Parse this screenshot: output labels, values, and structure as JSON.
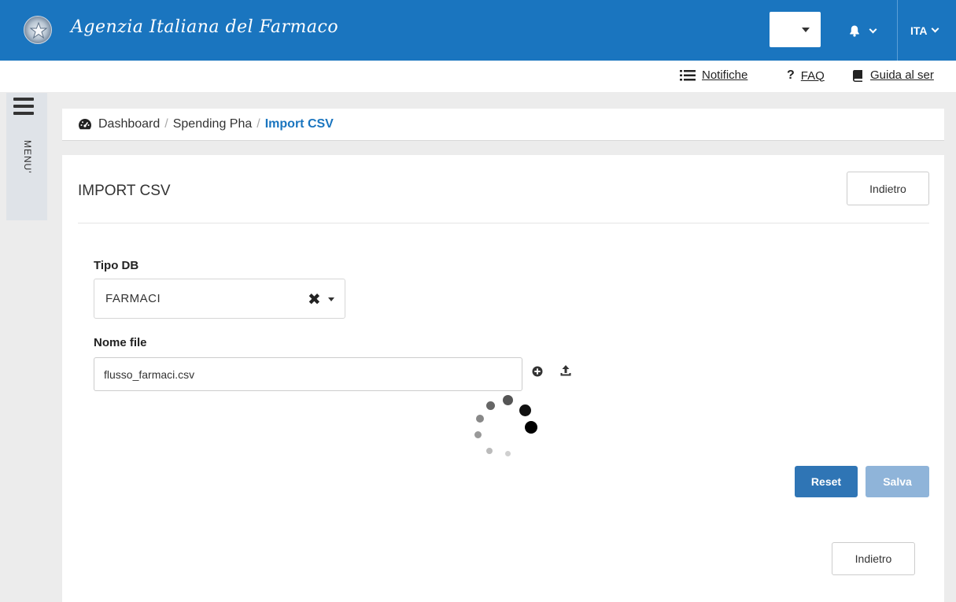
{
  "header": {
    "brand": "Agenzia Italiana del Farmaco",
    "language": "ITA"
  },
  "topnav": {
    "notifications": "Notifiche",
    "faq": "FAQ",
    "guide": "Guida al ser"
  },
  "sidebar": {
    "menu_label": "MENU'"
  },
  "breadcrumb": {
    "items": [
      "Dashboard",
      "Spending Pha",
      "Import CSV"
    ],
    "separator": "/"
  },
  "panel": {
    "title": "IMPORT CSV",
    "back_label": "Indietro",
    "tipo_db": {
      "label": "Tipo DB",
      "value": "FARMACI"
    },
    "nome_file": {
      "label": "Nome file",
      "value": "flusso_farmaci.csv"
    },
    "reset_label": "Reset",
    "save_label": "Salva",
    "back_bottom_label": "Indietro"
  },
  "colors": {
    "header_bg": "#1a75bf",
    "primary": "#2f75b5",
    "primary_disabled": "#8fb4d9"
  }
}
